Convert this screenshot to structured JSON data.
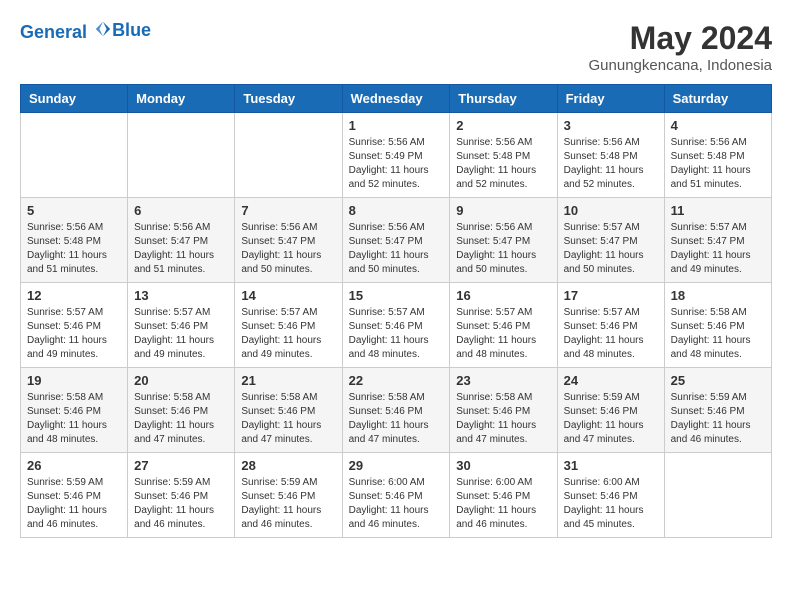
{
  "header": {
    "logo_line1": "General",
    "logo_line2": "Blue",
    "month": "May 2024",
    "location": "Gunungkencana, Indonesia"
  },
  "weekdays": [
    "Sunday",
    "Monday",
    "Tuesday",
    "Wednesday",
    "Thursday",
    "Friday",
    "Saturday"
  ],
  "weeks": [
    [
      {
        "day": "",
        "info": ""
      },
      {
        "day": "",
        "info": ""
      },
      {
        "day": "",
        "info": ""
      },
      {
        "day": "1",
        "info": "Sunrise: 5:56 AM\nSunset: 5:49 PM\nDaylight: 11 hours\nand 52 minutes."
      },
      {
        "day": "2",
        "info": "Sunrise: 5:56 AM\nSunset: 5:48 PM\nDaylight: 11 hours\nand 52 minutes."
      },
      {
        "day": "3",
        "info": "Sunrise: 5:56 AM\nSunset: 5:48 PM\nDaylight: 11 hours\nand 52 minutes."
      },
      {
        "day": "4",
        "info": "Sunrise: 5:56 AM\nSunset: 5:48 PM\nDaylight: 11 hours\nand 51 minutes."
      }
    ],
    [
      {
        "day": "5",
        "info": "Sunrise: 5:56 AM\nSunset: 5:48 PM\nDaylight: 11 hours\nand 51 minutes."
      },
      {
        "day": "6",
        "info": "Sunrise: 5:56 AM\nSunset: 5:47 PM\nDaylight: 11 hours\nand 51 minutes."
      },
      {
        "day": "7",
        "info": "Sunrise: 5:56 AM\nSunset: 5:47 PM\nDaylight: 11 hours\nand 50 minutes."
      },
      {
        "day": "8",
        "info": "Sunrise: 5:56 AM\nSunset: 5:47 PM\nDaylight: 11 hours\nand 50 minutes."
      },
      {
        "day": "9",
        "info": "Sunrise: 5:56 AM\nSunset: 5:47 PM\nDaylight: 11 hours\nand 50 minutes."
      },
      {
        "day": "10",
        "info": "Sunrise: 5:57 AM\nSunset: 5:47 PM\nDaylight: 11 hours\nand 50 minutes."
      },
      {
        "day": "11",
        "info": "Sunrise: 5:57 AM\nSunset: 5:47 PM\nDaylight: 11 hours\nand 49 minutes."
      }
    ],
    [
      {
        "day": "12",
        "info": "Sunrise: 5:57 AM\nSunset: 5:46 PM\nDaylight: 11 hours\nand 49 minutes."
      },
      {
        "day": "13",
        "info": "Sunrise: 5:57 AM\nSunset: 5:46 PM\nDaylight: 11 hours\nand 49 minutes."
      },
      {
        "day": "14",
        "info": "Sunrise: 5:57 AM\nSunset: 5:46 PM\nDaylight: 11 hours\nand 49 minutes."
      },
      {
        "day": "15",
        "info": "Sunrise: 5:57 AM\nSunset: 5:46 PM\nDaylight: 11 hours\nand 48 minutes."
      },
      {
        "day": "16",
        "info": "Sunrise: 5:57 AM\nSunset: 5:46 PM\nDaylight: 11 hours\nand 48 minutes."
      },
      {
        "day": "17",
        "info": "Sunrise: 5:57 AM\nSunset: 5:46 PM\nDaylight: 11 hours\nand 48 minutes."
      },
      {
        "day": "18",
        "info": "Sunrise: 5:58 AM\nSunset: 5:46 PM\nDaylight: 11 hours\nand 48 minutes."
      }
    ],
    [
      {
        "day": "19",
        "info": "Sunrise: 5:58 AM\nSunset: 5:46 PM\nDaylight: 11 hours\nand 48 minutes."
      },
      {
        "day": "20",
        "info": "Sunrise: 5:58 AM\nSunset: 5:46 PM\nDaylight: 11 hours\nand 47 minutes."
      },
      {
        "day": "21",
        "info": "Sunrise: 5:58 AM\nSunset: 5:46 PM\nDaylight: 11 hours\nand 47 minutes."
      },
      {
        "day": "22",
        "info": "Sunrise: 5:58 AM\nSunset: 5:46 PM\nDaylight: 11 hours\nand 47 minutes."
      },
      {
        "day": "23",
        "info": "Sunrise: 5:58 AM\nSunset: 5:46 PM\nDaylight: 11 hours\nand 47 minutes."
      },
      {
        "day": "24",
        "info": "Sunrise: 5:59 AM\nSunset: 5:46 PM\nDaylight: 11 hours\nand 47 minutes."
      },
      {
        "day": "25",
        "info": "Sunrise: 5:59 AM\nSunset: 5:46 PM\nDaylight: 11 hours\nand 46 minutes."
      }
    ],
    [
      {
        "day": "26",
        "info": "Sunrise: 5:59 AM\nSunset: 5:46 PM\nDaylight: 11 hours\nand 46 minutes."
      },
      {
        "day": "27",
        "info": "Sunrise: 5:59 AM\nSunset: 5:46 PM\nDaylight: 11 hours\nand 46 minutes."
      },
      {
        "day": "28",
        "info": "Sunrise: 5:59 AM\nSunset: 5:46 PM\nDaylight: 11 hours\nand 46 minutes."
      },
      {
        "day": "29",
        "info": "Sunrise: 6:00 AM\nSunset: 5:46 PM\nDaylight: 11 hours\nand 46 minutes."
      },
      {
        "day": "30",
        "info": "Sunrise: 6:00 AM\nSunset: 5:46 PM\nDaylight: 11 hours\nand 46 minutes."
      },
      {
        "day": "31",
        "info": "Sunrise: 6:00 AM\nSunset: 5:46 PM\nDaylight: 11 hours\nand 45 minutes."
      },
      {
        "day": "",
        "info": ""
      }
    ]
  ]
}
